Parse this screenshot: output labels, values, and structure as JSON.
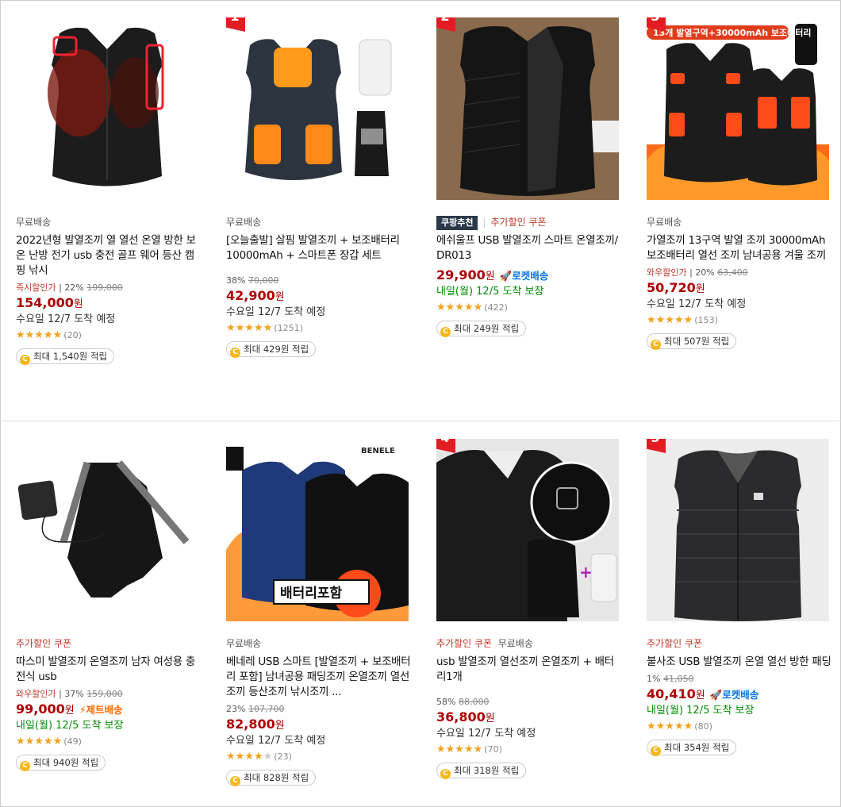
{
  "products": [
    {
      "rank": "",
      "tag": "무료배송",
      "title": "2022년형 발열조끼 열 열선 온열 방한 보온 난방 전기 usb 충전 골프 웨어 등산 캠핑 낚시",
      "discount_label": "즉시할인가",
      "discount_rate": "22%",
      "original_price": "199,000",
      "price": "154,000",
      "price_unit": "원",
      "badge": "",
      "delivery": "수요일 12/7 도착 예정",
      "rating": 5,
      "reviews": "(20)",
      "reward": "최대 1,540원 적립"
    },
    {
      "rank": "1",
      "tag": "무료배송",
      "title": "[오늘출발] 살핌 발열조끼 + 보조배터리 10000mAh + 스마트폰 장갑 세트",
      "discount_label": "",
      "discount_rate": "38%",
      "original_price": "70,000",
      "price": "42,900",
      "price_unit": "원",
      "badge": "",
      "delivery": "수요일 12/7 도착 예정",
      "rating": 4.5,
      "reviews": "(1251)",
      "reward": "최대 429원 적립"
    },
    {
      "rank": "2",
      "tag_pick": "쿠팡추천",
      "tag": "추가할인 쿠폰",
      "title": "에쉬울프 USB 발열조끼 스마트 온열조끼/ DR013",
      "discount_label": "",
      "discount_rate": "",
      "original_price": "",
      "price": "29,900",
      "price_unit": "원",
      "badge": "로켓배송",
      "delivery": "내일(월) 12/5 도착 보장",
      "rating": 4.5,
      "reviews": "(422)",
      "reward": "최대 249원 적립"
    },
    {
      "rank": "3",
      "tag": "무료배송",
      "title": "가열조끼 13구역 발열 조끼 30000mAh 보조배터리 열선 조끼 남녀공용 겨울 조끼",
      "discount_label": "와우할인가",
      "discount_rate": "20%",
      "original_price": "63,400",
      "price": "50,720",
      "price_unit": "원",
      "badge": "",
      "delivery": "수요일 12/7 도착 예정",
      "rating": 4.5,
      "reviews": "(153)",
      "reward": "최대 507원 적립"
    },
    {
      "rank": "",
      "tag": "추가할인 쿠폰",
      "title": "따스미 발열조끼 온열조끼 남자 여성용 충전식 usb",
      "discount_label": "와우할인가",
      "discount_rate": "37%",
      "original_price": "159,000",
      "price": "99,000",
      "price_unit": "원",
      "badge": "제트배송",
      "delivery": "내일(월) 12/5 도착 보장",
      "rating": 4.5,
      "reviews": "(49)",
      "reward": "최대 940원 적립"
    },
    {
      "rank": "",
      "tag": "무료배송",
      "title": "베네레 USB 스마트 [발열조끼 + 보조배터리 포함] 남녀공용 패딩조끼 온열조끼 열선조끼 등산조끼 낚시조끼 ...",
      "discount_label": "",
      "discount_rate": "23%",
      "original_price": "107,700",
      "price": "82,800",
      "price_unit": "원",
      "badge": "",
      "delivery": "수요일 12/7 도착 예정",
      "rating": 4,
      "reviews": "(23)",
      "reward": "최대 828원 적립"
    },
    {
      "rank": "4",
      "tag": "추가할인 쿠폰",
      "tag2": "무료배송",
      "title": "usb 발열조끼 열선조끼 온열조끼 + 배터리1개",
      "discount_label": "",
      "discount_rate": "58%",
      "original_price": "88,000",
      "price": "36,800",
      "price_unit": "원",
      "badge": "",
      "delivery": "수요일 12/7 도착 예정",
      "rating": 4.5,
      "reviews": "(70)",
      "reward": "최대 318원 적립"
    },
    {
      "rank": "5",
      "tag": "추가할인 쿠폰",
      "title": "불사조 USB 발열조끼 온열 열선 방한 패딩",
      "discount_label": "",
      "discount_rate": "1%",
      "original_price": "41,050",
      "price": "40,410",
      "price_unit": "원",
      "badge": "로켓배송",
      "delivery": "내일(월) 12/5 도착 보장",
      "rating": 4.5,
      "reviews": "(80)",
      "reward": "최대 354원 적립"
    }
  ],
  "image_text": {
    "p3_banner": "13개 발열구역+30000mAh 보조배터리",
    "p5_brand": "BENELE",
    "p5_battery": "배터리포함"
  },
  "colors": {
    "price": "#ae0000",
    "rank_flag": "#e31b23",
    "rocket": "#0073e9",
    "jet": "#ff6a00",
    "green_delivery": "#008c00",
    "star": "#f4a11b"
  }
}
